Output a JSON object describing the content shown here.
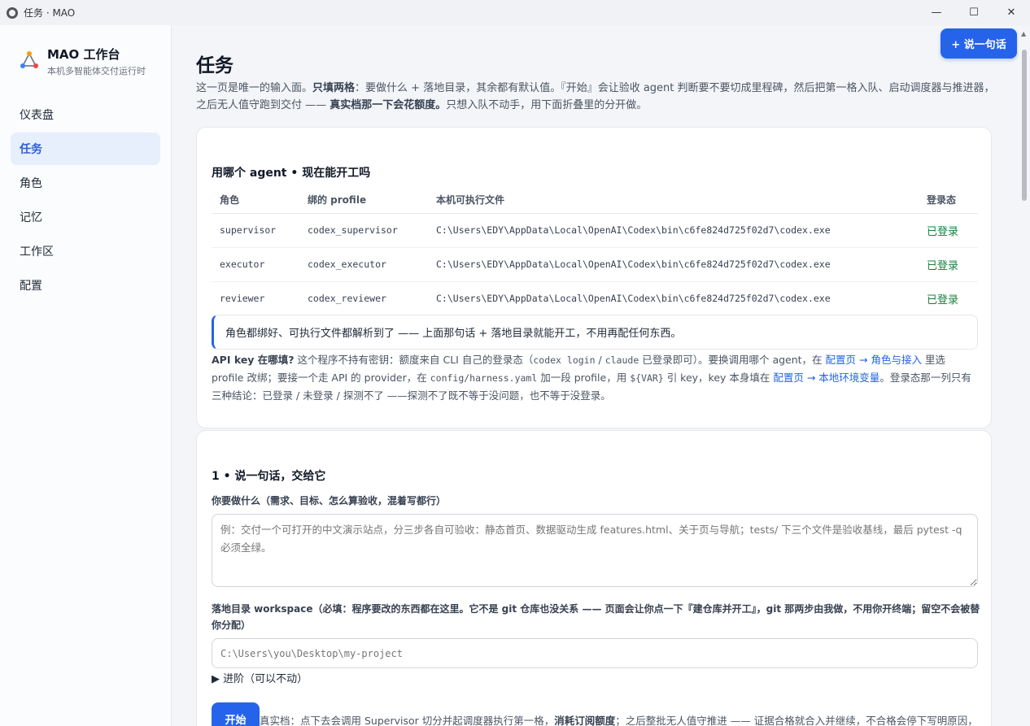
{
  "window": {
    "title": "任务 · MAO",
    "minimize": "—",
    "maximize": "☐",
    "close": "✕"
  },
  "brand": {
    "name": "MAO 工作台",
    "subtitle": "本机多智能体交付运行时"
  },
  "nav": [
    {
      "label": "仪表盘",
      "active": false
    },
    {
      "label": "任务",
      "active": true
    },
    {
      "label": "角色",
      "active": false
    },
    {
      "label": "记忆",
      "active": false
    },
    {
      "label": "工作区",
      "active": false
    },
    {
      "label": "配置",
      "active": false
    }
  ],
  "header": {
    "cta": "+ 说一句话",
    "title": "任务",
    "desc_1": "这一页是唯一的输入面。",
    "desc_2": "只填两格",
    "desc_3": "：要做什么 + 落地目录，其余都有默认值。『开始』会让验收 agent 判断要不要切成里程碑，然后把第一格入队、启动调度器与推进器，之后无人值守跑到交付 —— ",
    "desc_4": "真实档那一下会花额度。",
    "desc_5": "只想入队不动手，用下面折叠里的分开做。"
  },
  "agents_card": {
    "heading": "用哪个 agent • 现在能开工吗",
    "columns": [
      "角色",
      "绑的 profile",
      "本机可执行文件",
      "登录态"
    ],
    "rows": [
      {
        "role": "supervisor",
        "profile": "codex_supervisor",
        "exe": "C:\\Users\\EDY\\AppData\\Local\\OpenAI\\Codex\\bin\\c6fe824d725f02d7\\codex.exe",
        "status": "已登录"
      },
      {
        "role": "executor",
        "profile": "codex_executor",
        "exe": "C:\\Users\\EDY\\AppData\\Local\\OpenAI\\Codex\\bin\\c6fe824d725f02d7\\codex.exe",
        "status": "已登录"
      },
      {
        "role": "reviewer",
        "profile": "codex_reviewer",
        "exe": "C:\\Users\\EDY\\AppData\\Local\\OpenAI\\Codex\\bin\\c6fe824d725f02d7\\codex.exe",
        "status": "已登录"
      }
    ],
    "callout": "角色都绑好、可执行文件都解析到了 —— 上面那句话 + 落地目录就能开工，不用再配任何东西。",
    "note": {
      "q": "API key 在哪填?",
      "t1": " 这个程序不持有密钥：额度来自 CLI 自己的登录态（",
      "c1": "codex login",
      "t2": " / ",
      "c2": "claude",
      "t3": " 已登录即可）。要换调用哪个 agent，在 ",
      "l1": "配置页 → 角色与接入",
      "t4": " 里选 profile 改绑；要接一个走 API 的 provider，在 ",
      "c3": "config/harness.yaml",
      "t5": " 加一段 profile，用 ",
      "c4": "${VAR}",
      "t6": " 引 key，key 本身填在 ",
      "l2": "配置页 → 本地环境变量",
      "t7": "。登录态那一列只有三种结论：已登录 / 未登录 / 探测不了 ——探测不了既不等于没问题，也不等于没登录。"
    }
  },
  "task_card": {
    "heading": "1 • 说一句话，交给它",
    "need_label": "你要做什么（需求、目标、怎么算验收，混着写都行）",
    "need_placeholder": "例：交付一个可打开的中文演示站点，分三步各自可验收：静态首页、数据驱动生成 features.html、关于页与导航；tests/ 下三个文件是验收基线，最后 pytest -q 必须全绿。",
    "ws_label": "落地目录 workspace（必填：程序要改的东西都在这里。它不是 git 仓库也没关系 —— 页面会让你点一下『建仓库并开工』，git 那两步由我做，不用你开终端；留空不会被替你分配）",
    "ws_placeholder": "C:\\Users\\you\\Desktop\\my-project",
    "advanced": "▶ 进阶（可以不动）",
    "start": "开始",
    "start_note_1": "真实档：点下去会调用 Supervisor 切分并起调度器执行第一格，",
    "start_note_2": "消耗订阅额度",
    "start_note_3": "；之后整批无人值守推进 —— 证据合格就合入并继续，不合格会停下写明原因，"
  }
}
